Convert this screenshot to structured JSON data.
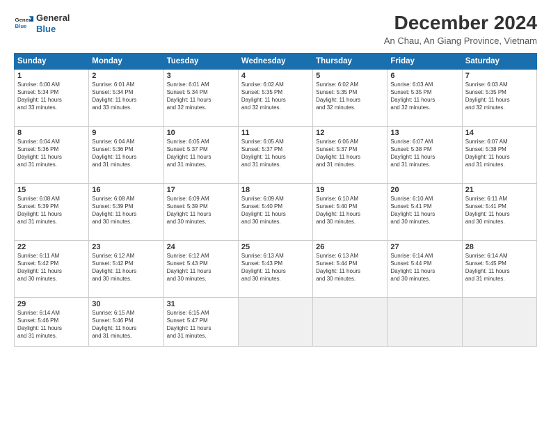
{
  "logo": {
    "line1": "General",
    "line2": "Blue"
  },
  "title": "December 2024",
  "subtitle": "An Chau, An Giang Province, Vietnam",
  "days_of_week": [
    "Sunday",
    "Monday",
    "Tuesday",
    "Wednesday",
    "Thursday",
    "Friday",
    "Saturday"
  ],
  "weeks": [
    [
      {
        "day": "1",
        "info": "Sunrise: 6:00 AM\nSunset: 5:34 PM\nDaylight: 11 hours\nand 33 minutes."
      },
      {
        "day": "2",
        "info": "Sunrise: 6:01 AM\nSunset: 5:34 PM\nDaylight: 11 hours\nand 33 minutes."
      },
      {
        "day": "3",
        "info": "Sunrise: 6:01 AM\nSunset: 5:34 PM\nDaylight: 11 hours\nand 32 minutes."
      },
      {
        "day": "4",
        "info": "Sunrise: 6:02 AM\nSunset: 5:35 PM\nDaylight: 11 hours\nand 32 minutes."
      },
      {
        "day": "5",
        "info": "Sunrise: 6:02 AM\nSunset: 5:35 PM\nDaylight: 11 hours\nand 32 minutes."
      },
      {
        "day": "6",
        "info": "Sunrise: 6:03 AM\nSunset: 5:35 PM\nDaylight: 11 hours\nand 32 minutes."
      },
      {
        "day": "7",
        "info": "Sunrise: 6:03 AM\nSunset: 5:35 PM\nDaylight: 11 hours\nand 32 minutes."
      }
    ],
    [
      {
        "day": "8",
        "info": "Sunrise: 6:04 AM\nSunset: 5:36 PM\nDaylight: 11 hours\nand 31 minutes."
      },
      {
        "day": "9",
        "info": "Sunrise: 6:04 AM\nSunset: 5:36 PM\nDaylight: 11 hours\nand 31 minutes."
      },
      {
        "day": "10",
        "info": "Sunrise: 6:05 AM\nSunset: 5:37 PM\nDaylight: 11 hours\nand 31 minutes."
      },
      {
        "day": "11",
        "info": "Sunrise: 6:05 AM\nSunset: 5:37 PM\nDaylight: 11 hours\nand 31 minutes."
      },
      {
        "day": "12",
        "info": "Sunrise: 6:06 AM\nSunset: 5:37 PM\nDaylight: 11 hours\nand 31 minutes."
      },
      {
        "day": "13",
        "info": "Sunrise: 6:07 AM\nSunset: 5:38 PM\nDaylight: 11 hours\nand 31 minutes."
      },
      {
        "day": "14",
        "info": "Sunrise: 6:07 AM\nSunset: 5:38 PM\nDaylight: 11 hours\nand 31 minutes."
      }
    ],
    [
      {
        "day": "15",
        "info": "Sunrise: 6:08 AM\nSunset: 5:39 PM\nDaylight: 11 hours\nand 31 minutes."
      },
      {
        "day": "16",
        "info": "Sunrise: 6:08 AM\nSunset: 5:39 PM\nDaylight: 11 hours\nand 30 minutes."
      },
      {
        "day": "17",
        "info": "Sunrise: 6:09 AM\nSunset: 5:39 PM\nDaylight: 11 hours\nand 30 minutes."
      },
      {
        "day": "18",
        "info": "Sunrise: 6:09 AM\nSunset: 5:40 PM\nDaylight: 11 hours\nand 30 minutes."
      },
      {
        "day": "19",
        "info": "Sunrise: 6:10 AM\nSunset: 5:40 PM\nDaylight: 11 hours\nand 30 minutes."
      },
      {
        "day": "20",
        "info": "Sunrise: 6:10 AM\nSunset: 5:41 PM\nDaylight: 11 hours\nand 30 minutes."
      },
      {
        "day": "21",
        "info": "Sunrise: 6:11 AM\nSunset: 5:41 PM\nDaylight: 11 hours\nand 30 minutes."
      }
    ],
    [
      {
        "day": "22",
        "info": "Sunrise: 6:11 AM\nSunset: 5:42 PM\nDaylight: 11 hours\nand 30 minutes."
      },
      {
        "day": "23",
        "info": "Sunrise: 6:12 AM\nSunset: 5:42 PM\nDaylight: 11 hours\nand 30 minutes."
      },
      {
        "day": "24",
        "info": "Sunrise: 6:12 AM\nSunset: 5:43 PM\nDaylight: 11 hours\nand 30 minutes."
      },
      {
        "day": "25",
        "info": "Sunrise: 6:13 AM\nSunset: 5:43 PM\nDaylight: 11 hours\nand 30 minutes."
      },
      {
        "day": "26",
        "info": "Sunrise: 6:13 AM\nSunset: 5:44 PM\nDaylight: 11 hours\nand 30 minutes."
      },
      {
        "day": "27",
        "info": "Sunrise: 6:14 AM\nSunset: 5:44 PM\nDaylight: 11 hours\nand 30 minutes."
      },
      {
        "day": "28",
        "info": "Sunrise: 6:14 AM\nSunset: 5:45 PM\nDaylight: 11 hours\nand 31 minutes."
      }
    ],
    [
      {
        "day": "29",
        "info": "Sunrise: 6:14 AM\nSunset: 5:46 PM\nDaylight: 11 hours\nand 31 minutes."
      },
      {
        "day": "30",
        "info": "Sunrise: 6:15 AM\nSunset: 5:46 PM\nDaylight: 11 hours\nand 31 minutes."
      },
      {
        "day": "31",
        "info": "Sunrise: 6:15 AM\nSunset: 5:47 PM\nDaylight: 11 hours\nand 31 minutes."
      },
      {
        "day": "",
        "info": ""
      },
      {
        "day": "",
        "info": ""
      },
      {
        "day": "",
        "info": ""
      },
      {
        "day": "",
        "info": ""
      }
    ]
  ]
}
